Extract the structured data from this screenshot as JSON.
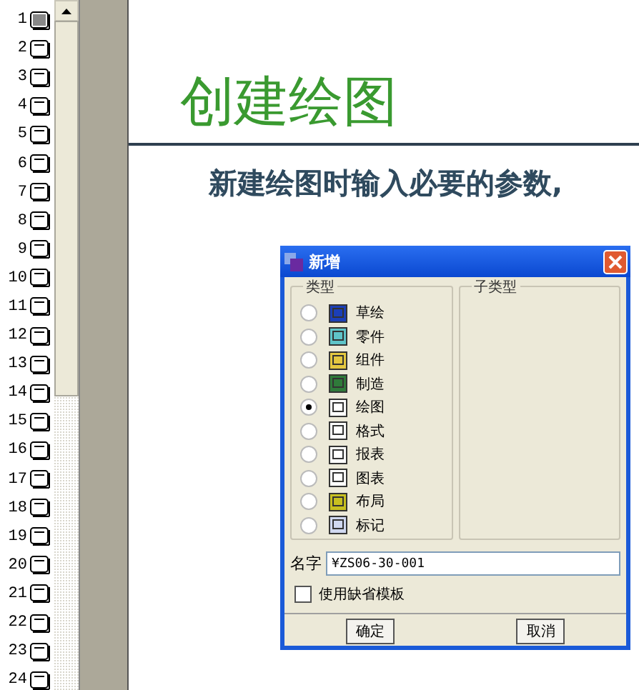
{
  "slides": [
    {
      "number": "1",
      "selected": true
    },
    {
      "number": "2",
      "selected": false
    },
    {
      "number": "3",
      "selected": false
    },
    {
      "number": "4",
      "selected": false
    },
    {
      "number": "5",
      "selected": false
    },
    {
      "number": "6",
      "selected": false
    },
    {
      "number": "7",
      "selected": false
    },
    {
      "number": "8",
      "selected": false
    },
    {
      "number": "9",
      "selected": false
    },
    {
      "number": "10",
      "selected": false
    },
    {
      "number": "11",
      "selected": false
    },
    {
      "number": "12",
      "selected": false
    },
    {
      "number": "13",
      "selected": false
    },
    {
      "number": "14",
      "selected": false
    },
    {
      "number": "15",
      "selected": false
    },
    {
      "number": "16",
      "selected": false
    },
    {
      "number": "17",
      "selected": false
    },
    {
      "number": "18",
      "selected": false
    },
    {
      "number": "19",
      "selected": false
    },
    {
      "number": "20",
      "selected": false
    },
    {
      "number": "21",
      "selected": false
    },
    {
      "number": "22",
      "selected": false
    },
    {
      "number": "23",
      "selected": false
    },
    {
      "number": "24",
      "selected": false
    }
  ],
  "slide": {
    "title": "创建绘图",
    "subtitle": "新建绘图时输入必要的参数,"
  },
  "dialog": {
    "title": "新增",
    "type_group": {
      "label": "类型",
      "options": [
        {
          "label": "草绘",
          "selected": false
        },
        {
          "label": "零件",
          "selected": false
        },
        {
          "label": "组件",
          "selected": false
        },
        {
          "label": "制造",
          "selected": false
        },
        {
          "label": "绘图",
          "selected": true
        },
        {
          "label": "格式",
          "selected": false
        },
        {
          "label": "报表",
          "selected": false
        },
        {
          "label": "图表",
          "selected": false
        },
        {
          "label": "布局",
          "selected": false
        },
        {
          "label": "标记",
          "selected": false
        }
      ]
    },
    "subtype_group": {
      "label": "子类型"
    },
    "name_label": "名字",
    "name_value": "¥ZS06-30-001",
    "default_template": {
      "label": "使用缺省模板",
      "checked": false
    },
    "buttons": [
      "确定",
      "取消"
    ]
  }
}
